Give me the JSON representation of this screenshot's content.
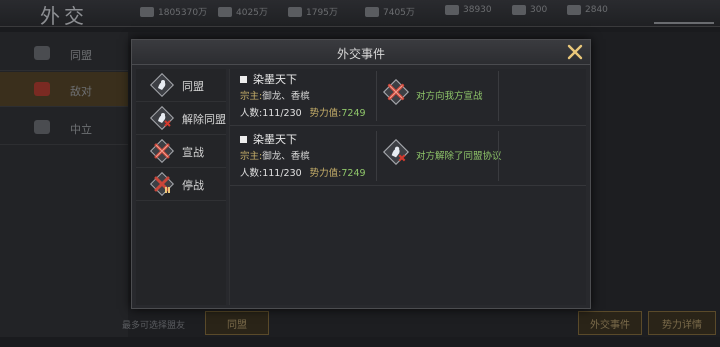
{
  "background": {
    "title": "外交",
    "resources": [
      {
        "icon": "food-icon",
        "value": "1805370万"
      },
      {
        "icon": "wood-icon",
        "value": "4025万"
      },
      {
        "icon": "stone-icon",
        "value": "1795万"
      },
      {
        "icon": "iron-icon",
        "value": "7405万"
      },
      {
        "icon": "silver-icon",
        "value": "38930"
      },
      {
        "icon": "gold-icon",
        "value": "300"
      },
      {
        "icon": "gem-icon",
        "value": "2840"
      }
    ],
    "sidebar": [
      {
        "label": "同盟",
        "active": false
      },
      {
        "label": "敌对",
        "active": true
      },
      {
        "label": "中立",
        "active": false
      }
    ],
    "bottom_label": "最多可选择盟友",
    "bottom_buttons": [
      "同盟",
      "外交事件",
      "势力详情"
    ]
  },
  "dialog": {
    "title": "外交事件",
    "categories": [
      {
        "icon": "alliance-icon",
        "label": "同盟"
      },
      {
        "icon": "dissolve-alliance-icon",
        "label": "解除同盟"
      },
      {
        "icon": "declare-war-icon",
        "label": "宣战"
      },
      {
        "icon": "ceasefire-icon",
        "label": "停战"
      }
    ],
    "events": [
      {
        "name": "染墨天下",
        "leader_label": "宗主:",
        "leader_value": "御龙、香槟",
        "members_label": "人数:",
        "members_value": "111/230",
        "power_label": "势力值:",
        "power_value": "7249",
        "event_icon": "declare-war-icon",
        "event_text": "对方向我方宣战"
      },
      {
        "name": "染墨天下",
        "leader_label": "宗主:",
        "leader_value": "御龙、香槟",
        "members_label": "人数:",
        "members_value": "111/230",
        "power_label": "势力值:",
        "power_value": "7249",
        "event_icon": "dissolve-alliance-icon",
        "event_text": "对方解除了同盟协议"
      }
    ]
  },
  "colors": {
    "accent_gold": "#c8b06a",
    "accent_green": "#8fc66a",
    "war_red": "#b8342a"
  }
}
